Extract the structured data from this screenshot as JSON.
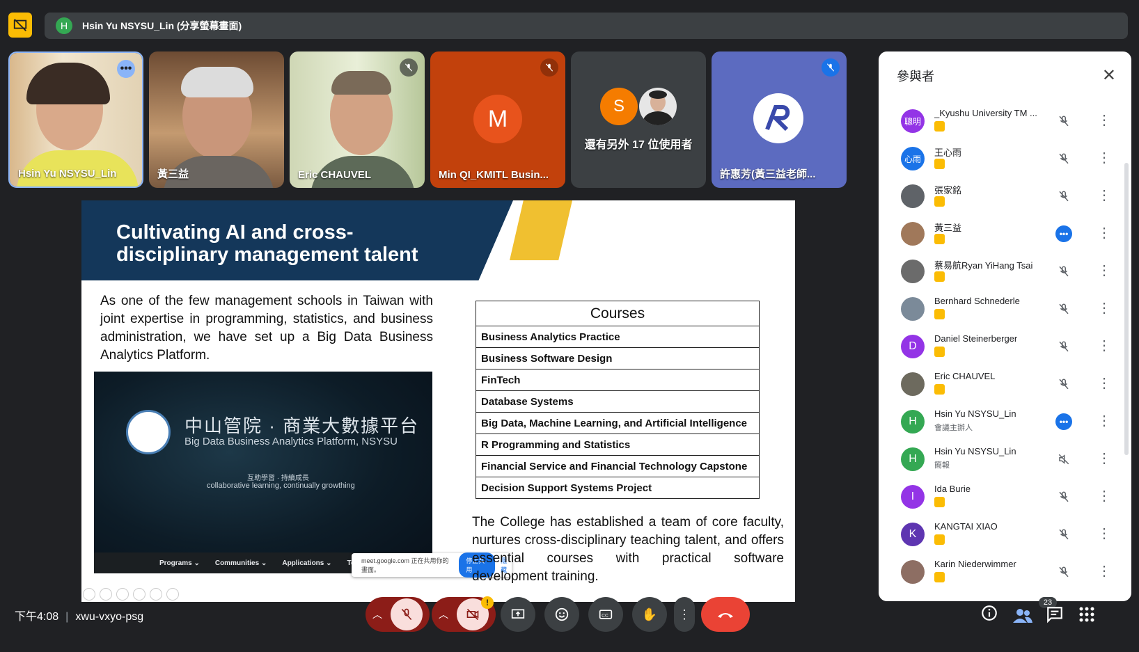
{
  "presenter_bar": {
    "avatar_letter": "H",
    "label": "Hsin Yu NSYSU_Lin (分享螢幕畫面)"
  },
  "tiles": [
    {
      "name": "Hsin Yu NSYSU_Lin"
    },
    {
      "name": "黃三益"
    },
    {
      "name": "Eric CHAUVEL"
    },
    {
      "name": "Min QI_KMITL Busin...",
      "letter": "M"
    },
    {
      "name": "還有另外 17 位使用者",
      "letter": "S"
    },
    {
      "name": "許惠芳(黃三益老師..."
    }
  ],
  "slide": {
    "title_line1": "Cultivating AI and cross-",
    "title_line2": "disciplinary management talent",
    "paragraph1": "As one of the few management schools in Taiwan with joint expertise in programming, statistics, and business administration, we have set up a Big Data Business Analytics Platform.",
    "paragraph2": "The College has established a team of core faculty, nurtures cross-disciplinary teaching talent, and offers essential courses with practical software development training.",
    "platform": {
      "title_cn": "中山管院 · 商業大數據平台",
      "title_en": "Big Data Business Analytics Platform, NSYSU",
      "motto_cn": "互助學習 · 持續成長",
      "motto_en": "collaborative learning, continually growthing",
      "nav": [
        "Programs ⌄",
        "Communities ⌄",
        "Applications ⌄",
        "Te"
      ]
    },
    "sharing_popup": {
      "text": "meet.google.com 正在共用你的畫面。",
      "stop": "停止共用",
      "hide": "隱藏"
    },
    "courses": {
      "header": "Courses",
      "items": [
        "Business Analytics Practice",
        "Business Software Design",
        "FinTech",
        "Database Systems",
        "Big Data, Machine Learning, and Artificial Intelligence",
        "R Programming and Statistics",
        "Financial Service and Financial Technology Capstone",
        "Decision Support Systems Project"
      ]
    }
  },
  "panel": {
    "title": "參與者",
    "participants": [
      {
        "name": "_Kyushu University TM ...",
        "avatar": "聰明",
        "color": "#9334e6",
        "mic": "muted"
      },
      {
        "name": "王心雨",
        "avatar": "心雨",
        "color": "#1a73e8",
        "mic": "muted"
      },
      {
        "name": "張家銘",
        "avatar": "",
        "color": "#5f6368",
        "mic": "muted"
      },
      {
        "name": "黃三益",
        "avatar": "",
        "color": "#a0785a",
        "mic": "talking"
      },
      {
        "name": "蔡易航Ryan YiHang Tsai",
        "avatar": "",
        "color": "#6b6b6b",
        "mic": "muted"
      },
      {
        "name": "Bernhard Schnederle",
        "avatar": "",
        "color": "#7b8a99",
        "mic": "muted"
      },
      {
        "name": "Daniel Steinerberger",
        "avatar": "D",
        "color": "#9334e6",
        "mic": "muted"
      },
      {
        "name": "Eric CHAUVEL",
        "avatar": "",
        "color": "#6d6a5e",
        "mic": "muted"
      },
      {
        "name": "Hsin Yu NSYSU_Lin",
        "avatar": "H",
        "color": "#34a853",
        "mic": "talking",
        "role": "會議主辦人"
      },
      {
        "name": "Hsin Yu NSYSU_Lin",
        "avatar": "H",
        "color": "#34a853",
        "mic": "presenting",
        "role": "簡報"
      },
      {
        "name": "Ida Burie",
        "avatar": "I",
        "color": "#9334e6",
        "mic": "muted"
      },
      {
        "name": "KANGTAI XIAO",
        "avatar": "K",
        "color": "#5e35b1",
        "mic": "muted"
      },
      {
        "name": "Karin Niederwimmer",
        "avatar": "",
        "color": "#8d6e63",
        "mic": "muted"
      }
    ]
  },
  "bottom": {
    "time": "下午4:08",
    "meeting_code": "xwu-vxyo-psg",
    "participants_count": "23"
  }
}
